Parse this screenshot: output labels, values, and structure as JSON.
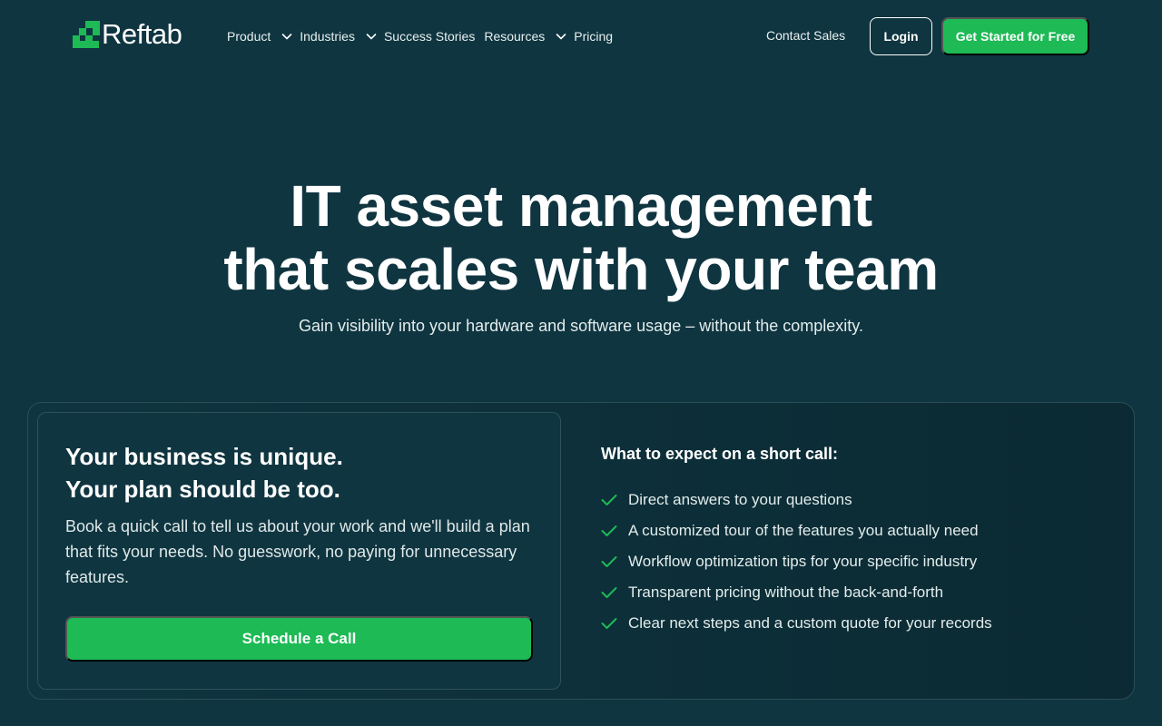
{
  "brand": {
    "name": "Reftab",
    "accent_color": "#1dba55",
    "background_color": "#0f3540"
  },
  "nav": {
    "items": [
      {
        "label": "Product",
        "has_dropdown": true
      },
      {
        "label": "Industries",
        "has_dropdown": true
      },
      {
        "label": "Success Stories",
        "has_dropdown": false
      },
      {
        "label": "Resources",
        "has_dropdown": true
      },
      {
        "label": "Pricing",
        "has_dropdown": false
      }
    ],
    "contact_sales": "Contact Sales",
    "login": "Login",
    "get_started": "Get Started for Free"
  },
  "hero": {
    "title_line1": "IT asset management",
    "title_line2": "that scales with your team",
    "subtitle": "Gain visibility into your hardware and software usage – without the complexity."
  },
  "plan_card": {
    "title_line1": "Your business is unique.",
    "title_line2": "Your plan should be too.",
    "description": "Book a quick call to tell us about your work and we'll build a plan that fits your needs. No guesswork, no paying for unnecessary features.",
    "button": "Schedule a Call"
  },
  "expect": {
    "title": "What to expect on a short call:",
    "items": [
      "Direct answers to your questions",
      "A customized tour of the features you actually need",
      "Workflow optimization tips for your specific industry",
      "Transparent pricing without the back-and-forth",
      "Clear next steps and a custom quote for your records"
    ],
    "icon": "check-icon"
  }
}
